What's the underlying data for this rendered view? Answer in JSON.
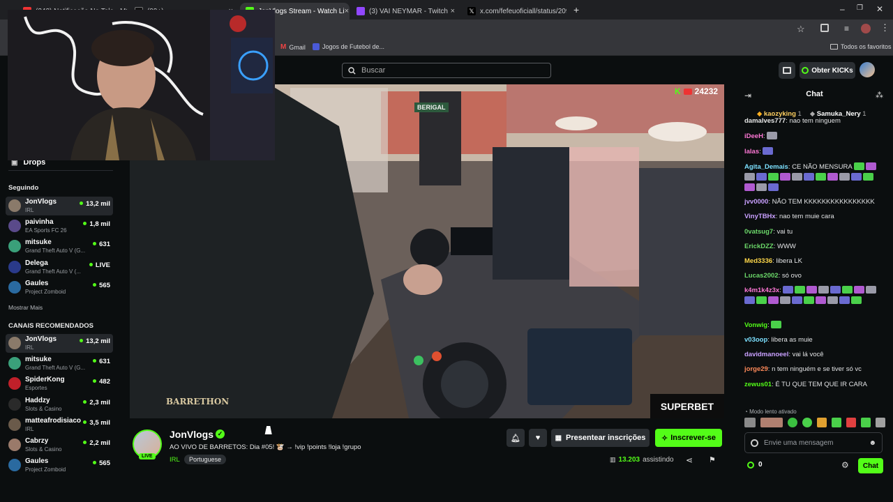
{
  "browser": {
    "tabs": [
      {
        "title": "(242) Notificação No Tela - MC",
        "close": "×"
      },
      {
        "title": "(99+)",
        "close": "×"
      },
      {
        "title": "JonVlogs Stream - Watch Li",
        "close": "×"
      },
      {
        "title": "(3) VAI NEYMAR - Twitch",
        "close": "×"
      },
      {
        "title": "x.com/fefeuoficiall/status/209",
        "close": "×"
      }
    ],
    "new_tab": "+",
    "window_controls": {
      "minimize": "–",
      "maximize": "❐",
      "close": "✕"
    },
    "bookmarks": [
      {
        "label": "Gmail"
      },
      {
        "label": "Jogos de Futebol de..."
      }
    ],
    "all_bookmarks": "Todos os favoritos"
  },
  "header": {
    "search_placeholder": "Buscar",
    "kicks_button": "Obter KICKs"
  },
  "sidebar": {
    "drops_label": "Drops",
    "following_title": "Seguindo",
    "following": [
      {
        "name": "JonVlogs",
        "category": "IRL",
        "viewers": "13,2 mil",
        "color": "#8a7a6a",
        "selected": true
      },
      {
        "name": "paivinha",
        "category": "EA Sports FC 26",
        "viewers": "1,8 mil",
        "color": "#5a4a8a"
      },
      {
        "name": "mitsuke",
        "category": "Grand Theft Auto V (G...",
        "viewers": "631",
        "color": "#3aa07a"
      },
      {
        "name": "Delega",
        "category": "Grand Theft Auto V (...",
        "viewers": "LIVE",
        "color": "#2a3a8a"
      },
      {
        "name": "Gaules",
        "category": "Project Zomboid",
        "viewers": "565",
        "color": "#2a6aa0"
      }
    ],
    "show_more": "Mostrar Mais",
    "recommended_title": "CANAIS RECOMENDADOS",
    "recommended": [
      {
        "name": "JonVlogs",
        "category": "IRL",
        "viewers": "13,2 mil",
        "color": "#8a7a6a",
        "selected": true
      },
      {
        "name": "mitsuke",
        "category": "Grand Theft Auto V (G...",
        "viewers": "631",
        "color": "#3aa07a"
      },
      {
        "name": "SpiderKong",
        "category": "Esportes",
        "viewers": "482",
        "color": "#c0202a"
      },
      {
        "name": "Haddzy",
        "category": "Slots & Casino",
        "viewers": "2,3 mil",
        "color": "#2a2a2a"
      },
      {
        "name": "matteafrodisiaco",
        "category": "IRL",
        "viewers": "3,5 mil",
        "color": "#6a5a4a"
      },
      {
        "name": "Cabrzy",
        "category": "Slots & Casino",
        "viewers": "2,2 mil",
        "color": "#9a7a6a"
      },
      {
        "name": "Gaules",
        "category": "Project Zomboid",
        "viewers": "565",
        "color": "#2a6aa0"
      }
    ]
  },
  "video": {
    "viewer_overlay": "24232",
    "sponsor_logo": "SUPERBET",
    "event_logo": "BARRETHON",
    "banner_text": "BERIGAL"
  },
  "stream": {
    "streamer": "JonVlogs",
    "live_badge": "LIVE",
    "title": "AO VIVO DE BARRETOS: Dia #05! 🐮 → !vip !points !loja !grupo",
    "category": "IRL",
    "language": "Portuguese",
    "gift_button": "Presentear inscrições",
    "subscribe_button": "Inscrever-se",
    "viewers": "13.203",
    "viewers_label": "assistindo"
  },
  "chat": {
    "title": "Chat",
    "top_gifters": [
      {
        "name": "kaozyking",
        "count": "1"
      },
      {
        "name": "Samuka_Nery",
        "count": "1"
      }
    ],
    "messages": [
      {
        "user": "damalves777",
        "color": "#e8e8e8",
        "text": "nao tem ninguem"
      },
      {
        "user": "iDeeH",
        "color": "#ff78d6",
        "text": ""
      },
      {
        "user": "lalas",
        "color": "#ff78d6",
        "text": ""
      },
      {
        "user": "Agita_Demais",
        "color": "#7ce0ff",
        "text": "CE NÃO MENSURA"
      },
      {
        "user": "jvv0000",
        "color": "#c9a0ff",
        "text": "NÃO TEM KKKKKKKKKKKKKKKK"
      },
      {
        "user": "VinyTBHx",
        "color": "#c9a0ff",
        "text": "nao tem muie cara"
      },
      {
        "user": "0vatsug7",
        "color": "#6cd96a",
        "text": "vai tu"
      },
      {
        "user": "ErickDZZ",
        "color": "#6cd96a",
        "text": "WWW"
      },
      {
        "user": "Med3336",
        "color": "#ffd84a",
        "text": "libera LK"
      },
      {
        "user": "Lucas2002",
        "color": "#6cd96a",
        "text": "só ovo"
      },
      {
        "user": "k4m1k4z3x",
        "color": "#ff78d6",
        "text": ""
      },
      {
        "user": "Vonwig",
        "color": "#53fc18",
        "text": ""
      },
      {
        "user": "v03oop",
        "color": "#7ce0ff",
        "text": "libera as muie"
      },
      {
        "user": "davidmanoeel",
        "color": "#c9a0ff",
        "text": "vai lá você"
      },
      {
        "user": "jorge29",
        "color": "#ff8a5a",
        "text": "n tem ninguém e se tiver só vc"
      },
      {
        "user": "zewus01",
        "color": "#53fc18",
        "text": "É TU QUE TEM QUE IR CARA"
      }
    ],
    "slow_mode": "Modo lento ativado",
    "input_placeholder": "Envie uma mensagem",
    "points": "0",
    "send_button": "Chat"
  },
  "colors": {
    "accent": "#53fc18",
    "background": "#0b0e0f",
    "panel": "#191b1f"
  }
}
